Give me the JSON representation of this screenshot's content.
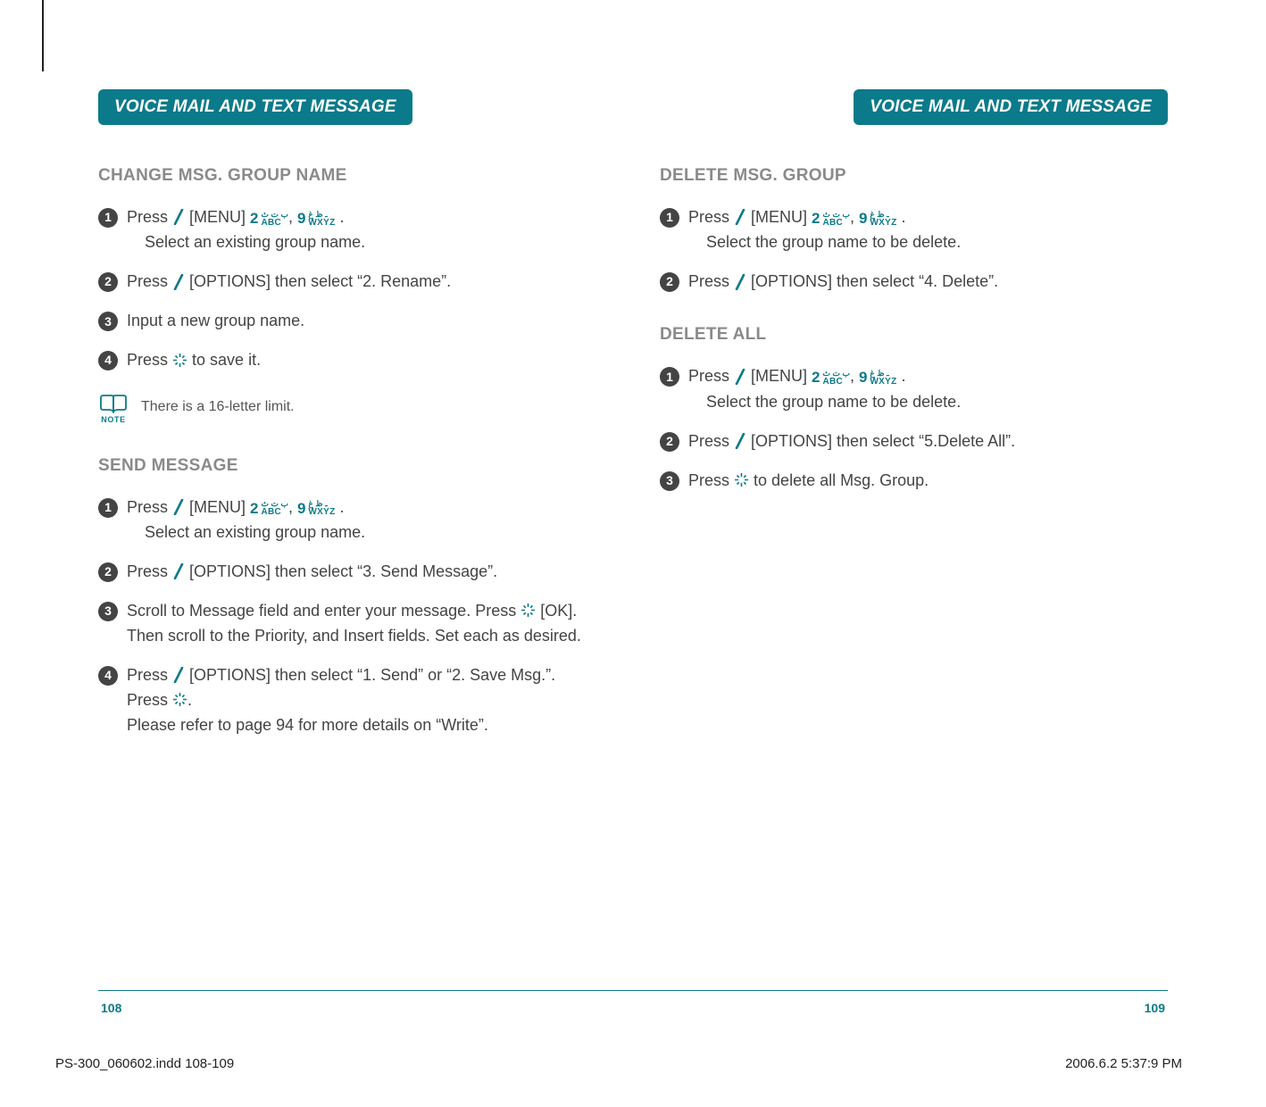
{
  "banner_left": "VOICE MAIL AND TEXT MESSAGE",
  "banner_right": "VOICE MAIL AND TEXT MESSAGE",
  "left": {
    "section1_title": "CHANGE MSG. GROUP NAME",
    "s1_step1_a": "Press ",
    "s1_step1_b": " [MENU]  ",
    "s1_step1_c": " .",
    "s1_step1_indent": "Select an existing group name.",
    "s1_step2_a": "Press ",
    "s1_step2_b": " [OPTIONS] then select “2. Rename”.",
    "s1_step3": "Input a new group name.",
    "s1_step4_a": "Press ",
    "s1_step4_b": " to save it.",
    "note_text": "There is a 16-letter limit.",
    "note_label": "NOTE",
    "section2_title": "SEND MESSAGE",
    "s2_step1_a": "Press ",
    "s2_step1_b": " [MENU]  ",
    "s2_step1_c": " .",
    "s2_step1_indent": "Select an existing group name.",
    "s2_step2_a": "Press ",
    "s2_step2_b": " [OPTIONS] then select “3. Send Message”.",
    "s2_step3_a": "Scroll to Message field and enter your message. Press",
    "s2_step3_b": " [OK]. Then scroll to the Priority, and Insert fields. Set each as desired.",
    "s2_step4_a": "Press ",
    "s2_step4_b": " [OPTIONS] then select “1. Send” or “2. Save Msg.”.",
    "s2_step4_c": "Press ",
    "s2_step4_d": ".",
    "s2_step4_e": "Please refer to page 94 for more details on “Write”."
  },
  "right": {
    "section1_title": "DELETE MSG. GROUP",
    "r1_step1_a": "Press ",
    "r1_step1_b": " [MENU]  ",
    "r1_step1_c": " .",
    "r1_step1_indent": "Select the group name to be delete.",
    "r1_step2_a": "Press ",
    "r1_step2_b": " [OPTIONS] then select “4. Delete”.",
    "section2_title": "DELETE ALL",
    "r2_step1_a": "Press ",
    "r2_step1_b": " [MENU]  ",
    "r2_step1_c": " .",
    "r2_step1_indent": "Select the group name to be delete.",
    "r2_step2_a": "Press ",
    "r2_step2_b": " [OPTIONS] then select “5.Delete All”.",
    "r2_step3_a": "Press ",
    "r2_step3_b": " to delete all Msg. Group."
  },
  "keys": {
    "two_num": "2",
    "two_sub": "ABC",
    "sep": ", ",
    "nine_num": "9",
    "nine_sub": "WXYZ"
  },
  "page_left": "108",
  "page_right": "109",
  "print_left": "PS-300_060602.indd   108-109",
  "print_right": "2006.6.2   5:37:9 PM"
}
